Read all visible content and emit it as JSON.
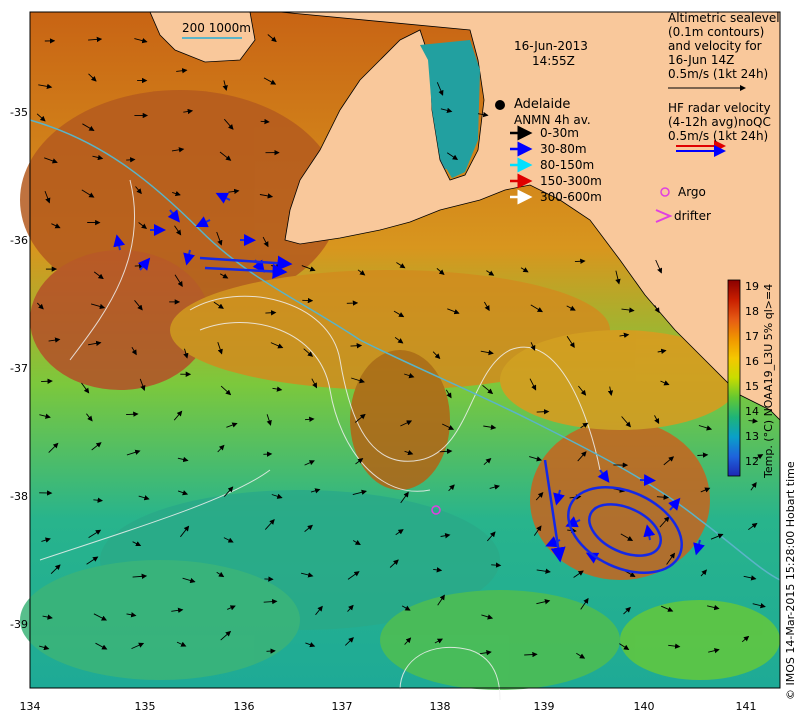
{
  "map": {
    "date": "16-Jun-2013",
    "time": "14:55Z",
    "city": "Adelaide",
    "scale_bar_label": "200  1000m",
    "colors": {
      "land": "#f9c89b",
      "warm": "#c86414",
      "mid": "#e6b400",
      "cool": "#32b478",
      "cold": "#0a9cc8"
    },
    "x_ticks": [
      "134",
      "135",
      "136",
      "137",
      "138",
      "139",
      "140",
      "141"
    ],
    "y_ticks": [
      "-35",
      "-36",
      "-37",
      "-38",
      "-39"
    ]
  },
  "altimetry_legend": {
    "line1": "Altimetric sealevel",
    "line2": "(0.1m contours)",
    "line3": "and velocity for",
    "line4": "16-Jun 14Z",
    "line5": "0.5m/s (1kt 24h)"
  },
  "hf_legend": {
    "line1": "HF radar velocity",
    "line2": "(4-12h avg)",
    "qc": "noQC",
    "line3": "0.5m/s (1kt 24h)"
  },
  "anmn_legend": {
    "title": "ANMN 4h av.",
    "items": [
      {
        "label": "0-30m",
        "color": "#000000"
      },
      {
        "label": "30-80m",
        "color": "#0000ff"
      },
      {
        "label": "80-150m",
        "color": "#00e0ff"
      },
      {
        "label": "150-300m",
        "color": "#e00000"
      },
      {
        "label": "300-600m",
        "color": "#ffffff"
      }
    ]
  },
  "markers": {
    "argo": "Argo",
    "drifter": "drifter"
  },
  "colorbar": {
    "ticks": [
      "19",
      "18",
      "17",
      "16",
      "15",
      "14",
      "13",
      "12"
    ],
    "label": "Temp. (°C) NOAA19_L3U 5% ql>=4",
    "colors": [
      "#8a0000",
      "#c81e00",
      "#e65a14",
      "#f09600",
      "#f5c800",
      "#c8dc00",
      "#64c832",
      "#1eb478",
      "#0aa0c8",
      "#1e64dc",
      "#1e28b4"
    ]
  },
  "credit": "© IMOS 14-Mar-2015 15:28:00 Hobart time"
}
